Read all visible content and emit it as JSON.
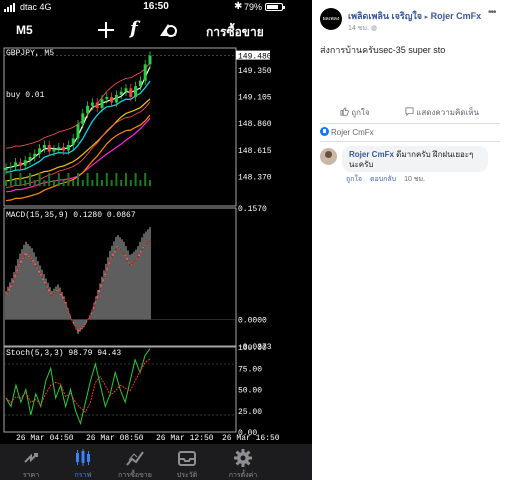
{
  "status_bar": {
    "carrier": "dtac  4G",
    "time": "16:50",
    "battery": "79%",
    "battery_level": 0.79
  },
  "toolbar": {
    "timeframe": "M5",
    "orders_label": "การซื้อขาย",
    "icons": [
      "plus-icon",
      "function-icon",
      "objects-icon"
    ]
  },
  "chart_data": [
    {
      "type": "line",
      "title": "GBPJPY, M5",
      "annotation": "buy 0.01",
      "ylim": [
        148.1,
        149.55
      ],
      "y_ticks": [
        "149.350",
        "149.105",
        "148.860",
        "148.615",
        "148.370"
      ],
      "last_price": "149.480",
      "x_labels": [
        "26 Mar 04:50",
        "26 Mar 08:50",
        "26 Mar 12:50",
        "26 Mar 16:50"
      ],
      "series": [
        {
          "values": [
            148.45,
            148.46,
            148.5,
            148.47,
            148.52,
            148.55,
            148.58,
            148.63,
            148.66,
            148.6,
            148.62,
            148.64,
            148.61,
            148.66,
            148.72,
            148.85,
            148.95,
            149.02,
            149.05,
            149.0,
            149.08,
            149.1,
            149.05,
            149.12,
            149.15,
            149.18,
            149.1,
            149.2,
            149.25,
            149.4,
            149.48
          ]
        }
      ]
    },
    {
      "type": "bar",
      "title": "MACD(15,35,9) 0.1280 0.0867",
      "ylim": [
        -0.0373,
        0.157
      ],
      "y_ticks": [
        "0.1570",
        "0.0000",
        "-0.0373"
      ],
      "values": [
        0.04,
        0.06,
        0.09,
        0.11,
        0.1,
        0.08,
        0.06,
        0.04,
        0.05,
        0.03,
        0.0,
        -0.02,
        -0.01,
        0.01,
        0.04,
        0.07,
        0.1,
        0.12,
        0.11,
        0.09,
        0.1,
        0.12,
        0.13
      ]
    },
    {
      "type": "line",
      "title": "Stoch(5,3,3) 98.79 94.43",
      "ylim": [
        0,
        100
      ],
      "y_ticks": [
        "100.00",
        "75.00",
        "50.00",
        "25.00",
        "0.00"
      ],
      "values": [
        40,
        30,
        55,
        35,
        50,
        20,
        45,
        30,
        60,
        75,
        40,
        55,
        30,
        50,
        25,
        10,
        35,
        60,
        80,
        55,
        30,
        45,
        70,
        50,
        35,
        60,
        85,
        70,
        90,
        98
      ]
    }
  ],
  "tabs": [
    {
      "label": "ราคา",
      "icon": "quotes-icon"
    },
    {
      "label": "กราฟ",
      "icon": "chart-icon",
      "active": true
    },
    {
      "label": "การซื้อขาย",
      "icon": "trade-icon"
    },
    {
      "label": "ประวัติ",
      "icon": "history-icon"
    },
    {
      "label": "การตั้งค่า",
      "icon": "settings-icon"
    }
  ],
  "post": {
    "avatar_text": "ผลเพลง",
    "author": "เพลิดเพลิน เจริญใจ",
    "page": "Rojer CmFx",
    "time": "14 ชม.",
    "text": "ส่งการบ้านครับsec-35 super sto",
    "like_label": "ถูกใจ",
    "comment_label": "แสดงความคิดเห็น",
    "liked_by": "Rojer CmFx"
  },
  "comment": {
    "author": "Rojer CmFx",
    "text": "ดีมากครับ ฝึกฝนเยอะๆนะครับ",
    "like_label": "ถูกใจ",
    "reply_label": "ตอบกลับ",
    "time": "10 ชม."
  }
}
